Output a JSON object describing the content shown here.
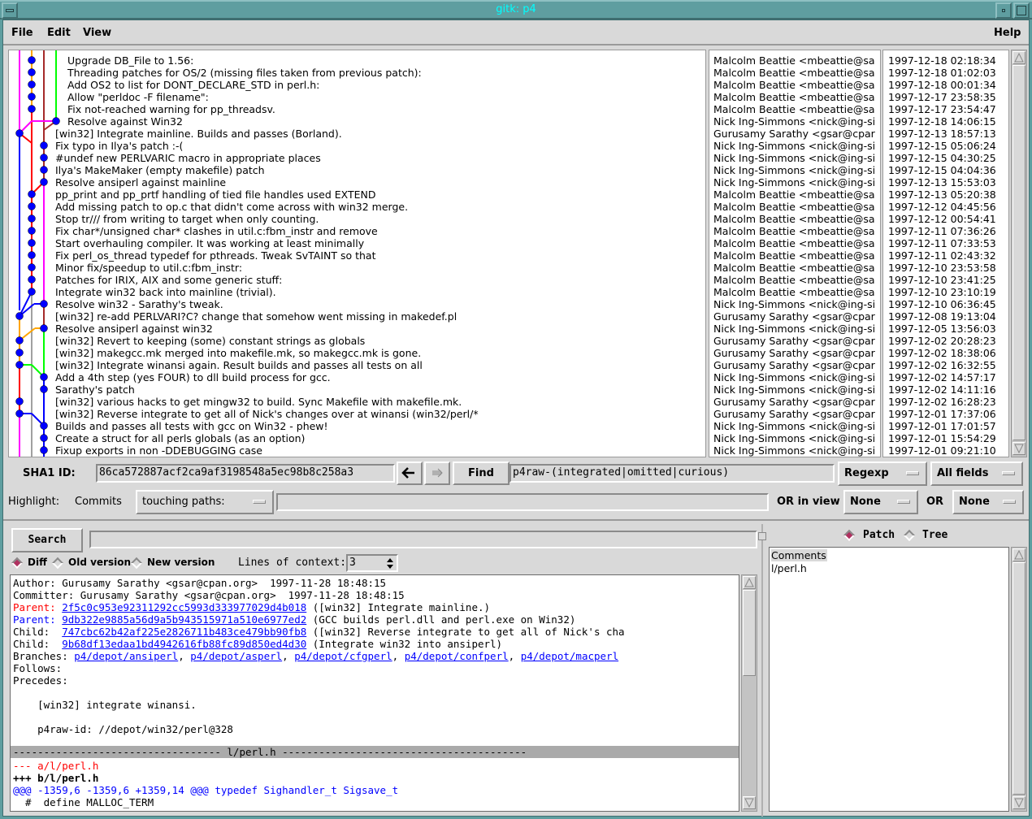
{
  "window": {
    "title": "gitk: p4"
  },
  "menu": {
    "file": "File",
    "edit": "Edit",
    "view": "View",
    "help": "Help"
  },
  "colors": {
    "node": "#0000ff",
    "link": "#0000ff",
    "parent_red": "#ff0000",
    "hunk_blue": "#0000ff",
    "radio_selected": "#b03060",
    "title_text": "#00ffff"
  },
  "commits": [
    {
      "subject": "Upgrade DB_File to 1.56:",
      "author": "Malcolm Beattie <mbeattie@sa",
      "date": "1997-12-18 02:18:34"
    },
    {
      "subject": "Threading patches for OS/2 (missing files taken from previous patch):",
      "author": "Malcolm Beattie <mbeattie@sa",
      "date": "1997-12-18 01:02:03"
    },
    {
      "subject": "Add OS2 to list for DONT_DECLARE_STD in perl.h:",
      "author": "Malcolm Beattie <mbeattie@sa",
      "date": "1997-12-18 00:01:34"
    },
    {
      "subject": "Allow \"perldoc -F filename\":",
      "author": "Malcolm Beattie <mbeattie@sa",
      "date": "1997-12-17 23:58:35"
    },
    {
      "subject": "Fix not-reached warning for pp_threadsv.",
      "author": "Malcolm Beattie <mbeattie@sa",
      "date": "1997-12-17 23:54:47"
    },
    {
      "subject": "Resolve against Win32",
      "author": "Nick Ing-Simmons <nick@ing-si",
      "date": "1997-12-18 14:06:15"
    },
    {
      "subject": "[win32] Integrate mainline.  Builds and passes (Borland).",
      "author": "Gurusamy Sarathy <gsar@cpar",
      "date": "1997-12-13 18:57:13"
    },
    {
      "subject": "Fix typo in Ilya's patch :-(",
      "author": "Nick Ing-Simmons <nick@ing-si",
      "date": "1997-12-15 05:06:24"
    },
    {
      "subject": "#undef new PERLVARIC macro in appropriate places",
      "author": "Nick Ing-Simmons <nick@ing-si",
      "date": "1997-12-15 04:30:25"
    },
    {
      "subject": "Ilya's MakeMaker (empty makefile) patch",
      "author": "Nick Ing-Simmons <nick@ing-si",
      "date": "1997-12-15 04:04:36"
    },
    {
      "subject": "Resolve ansiperl against mainline",
      "author": "Nick Ing-Simmons <nick@ing-si",
      "date": "1997-12-13 15:53:03"
    },
    {
      "subject": "pp_print and pp_prtf handling of tied file handles used EXTEND",
      "author": "Malcolm Beattie <mbeattie@sa",
      "date": "1997-12-13 05:20:38"
    },
    {
      "subject": "Add missing patch to op.c that didn't come across with win32 merge.",
      "author": "Malcolm Beattie <mbeattie@sa",
      "date": "1997-12-12 04:45:56"
    },
    {
      "subject": "Stop tr/// from writing to target when only counting.",
      "author": "Malcolm Beattie <mbeattie@sa",
      "date": "1997-12-12 00:54:41"
    },
    {
      "subject": "Fix char*/unsigned char* clashes in util.c:fbm_instr and remove",
      "author": "Malcolm Beattie <mbeattie@sa",
      "date": "1997-12-11 07:36:26"
    },
    {
      "subject": "Start overhauling compiler. It was working at least minimally",
      "author": "Malcolm Beattie <mbeattie@sa",
      "date": "1997-12-11 07:33:53"
    },
    {
      "subject": "Fix perl_os_thread typedef for pthreads. Tweak SvTAINT so that",
      "author": "Malcolm Beattie <mbeattie@sa",
      "date": "1997-12-11 02:43:32"
    },
    {
      "subject": "Minor fix/speedup to util.c:fbm_instr:",
      "author": "Malcolm Beattie <mbeattie@sa",
      "date": "1997-12-10 23:53:58"
    },
    {
      "subject": "Patches for IRIX, AIX and some generic stuff:",
      "author": "Malcolm Beattie <mbeattie@sa",
      "date": "1997-12-10 23:41:25"
    },
    {
      "subject": "Integrate win32 back into mainline (trivial).",
      "author": "Malcolm Beattie <mbeattie@sa",
      "date": "1997-12-10 23:10:19"
    },
    {
      "subject": "Resolve win32 - Sarathy's tweak.",
      "author": "Nick Ing-Simmons <nick@ing-si",
      "date": "1997-12-10 06:36:45"
    },
    {
      "subject": "[win32] re-add PERLVARI?C? change that somehow went missing in makedef.pl",
      "author": "Gurusamy Sarathy <gsar@cpar",
      "date": "1997-12-08 19:13:04"
    },
    {
      "subject": "Resolve ansiperl against win32",
      "author": "Nick Ing-Simmons <nick@ing-si",
      "date": "1997-12-05 13:56:03"
    },
    {
      "subject": "[win32] Revert to keeping (some) constant strings as globals",
      "author": "Gurusamy Sarathy <gsar@cpar",
      "date": "1997-12-02 20:28:23"
    },
    {
      "subject": "[win32] makegcc.mk merged into makefile.mk, so makegcc.mk is gone.",
      "author": "Gurusamy Sarathy <gsar@cpar",
      "date": "1997-12-02 18:38:06"
    },
    {
      "subject": "[win32] Integrate winansi again.  Result builds and passes all tests on all",
      "author": "Gurusamy Sarathy <gsar@cpar",
      "date": "1997-12-02 16:32:55"
    },
    {
      "subject": "Add a 4th step (yes FOUR) to dll build process for gcc.",
      "author": "Nick Ing-Simmons <nick@ing-si",
      "date": "1997-12-02 14:57:17"
    },
    {
      "subject": "Sarathy's patch",
      "author": "Nick Ing-Simmons <nick@ing-si",
      "date": "1997-12-02 14:11:16"
    },
    {
      "subject": "[win32] various hacks to get mingw32 to build.  Sync Makefile with makefile.mk.",
      "author": "Gurusamy Sarathy <gsar@cpar",
      "date": "1997-12-02 16:28:23"
    },
    {
      "subject": "[win32] Reverse integrate to get all of Nick's changes over at winansi (win32/perl/*",
      "author": "Gurusamy Sarathy <gsar@cpar",
      "date": "1997-12-01 17:37:06"
    },
    {
      "subject": "Builds and passes all tests with gcc on Win32 - phew!",
      "author": "Nick Ing-Simmons <nick@ing-si",
      "date": "1997-12-01 17:01:57"
    },
    {
      "subject": "Create a struct for all perls globals (as an option)",
      "author": "Nick Ing-Simmons <nick@ing-si",
      "date": "1997-12-01 15:54:29"
    },
    {
      "subject": "Fixup exports in non -DDEBUGGING case",
      "author": "Nick Ing-Simmons <nick@ing-si",
      "date": "1997-12-01 09:21:10"
    }
  ],
  "toolbar": {
    "sha1_label": "SHA1 ID:",
    "sha1_value": "86ca572887acf2ca9af3198548a5ec98b8c258a3",
    "back_icon": "arrow-left-icon",
    "forward_icon": "arrow-right-icon",
    "find_label": "Find",
    "find_value": "p4raw-(integrated|omitted|curious)",
    "find_type": "Regexp",
    "find_fields": "All fields"
  },
  "highlight": {
    "label": "Highlight:",
    "commits_label": "Commits",
    "mode": "touching paths:",
    "paths_value": "",
    "or_in_view_label": "OR in view",
    "view_value": "None",
    "or_label": "OR",
    "or_value": "None"
  },
  "diff_toolbar": {
    "search_label": "Search",
    "search_value": "",
    "radio_diff": "Diff",
    "radio_old": "Old version",
    "radio_new": "New version",
    "selected": "Diff",
    "context_label": "Lines of context:",
    "context_value": "3"
  },
  "details": {
    "author": "Author: Gurusamy Sarathy <gsar@cpan.org>  1997-11-28 18:48:15",
    "committer": "Committer: Gurusamy Sarathy <gsar@cpan.org>  1997-11-28 18:48:15",
    "parents": [
      {
        "label": "Parent: ",
        "sha": "2f5c0c953e92311292cc5993d333977029d4b018",
        "desc": " ([win32] Integrate mainline.)"
      },
      {
        "label": "Parent: ",
        "sha": "9db322e9885a56d9a5b943515971a510e6977ed2",
        "desc": " (GCC builds perl.dll and perl.exe on Win32)"
      }
    ],
    "children": [
      {
        "label": "Child:  ",
        "sha": "747cbc62b42af225e2826711b483ce479bb90fb8",
        "desc": " ([win32] Reverse integrate to get all of Nick's cha"
      },
      {
        "label": "Child:  ",
        "sha": "9b68df13edaa1bd4942616fb88fc89d850ed4d30",
        "desc": " (Integrate win32 into ansiperl)"
      }
    ],
    "branches_label": "Branches: ",
    "branches": [
      "p4/depot/ansiperl",
      "p4/depot/asperl",
      "p4/depot/cfgperl",
      "p4/depot/confperl",
      "p4/depot/macperl"
    ],
    "follows": "Follows:",
    "precedes": "Precedes:",
    "message_1": "    [win32] integrate winansi.",
    "message_2": "    p4raw-id: //depot/win32/perl@328",
    "file_header": "---------------------------------- l/perl.h ----------------------------------------",
    "minus_line": "--- a/l/perl.h",
    "plus_line": "+++ b/l/perl.h",
    "hunk_line": "@@@ -1359,6 -1359,6 +1359,14 @@@ typedef Sighandler_t Sigsave_t",
    "context_line": "  #  define MALLOC_TERM"
  },
  "file_panel": {
    "radio_patch": "Patch",
    "radio_tree": "Tree",
    "selected": "Patch",
    "items": [
      "Comments",
      "l/perl.h"
    ]
  }
}
